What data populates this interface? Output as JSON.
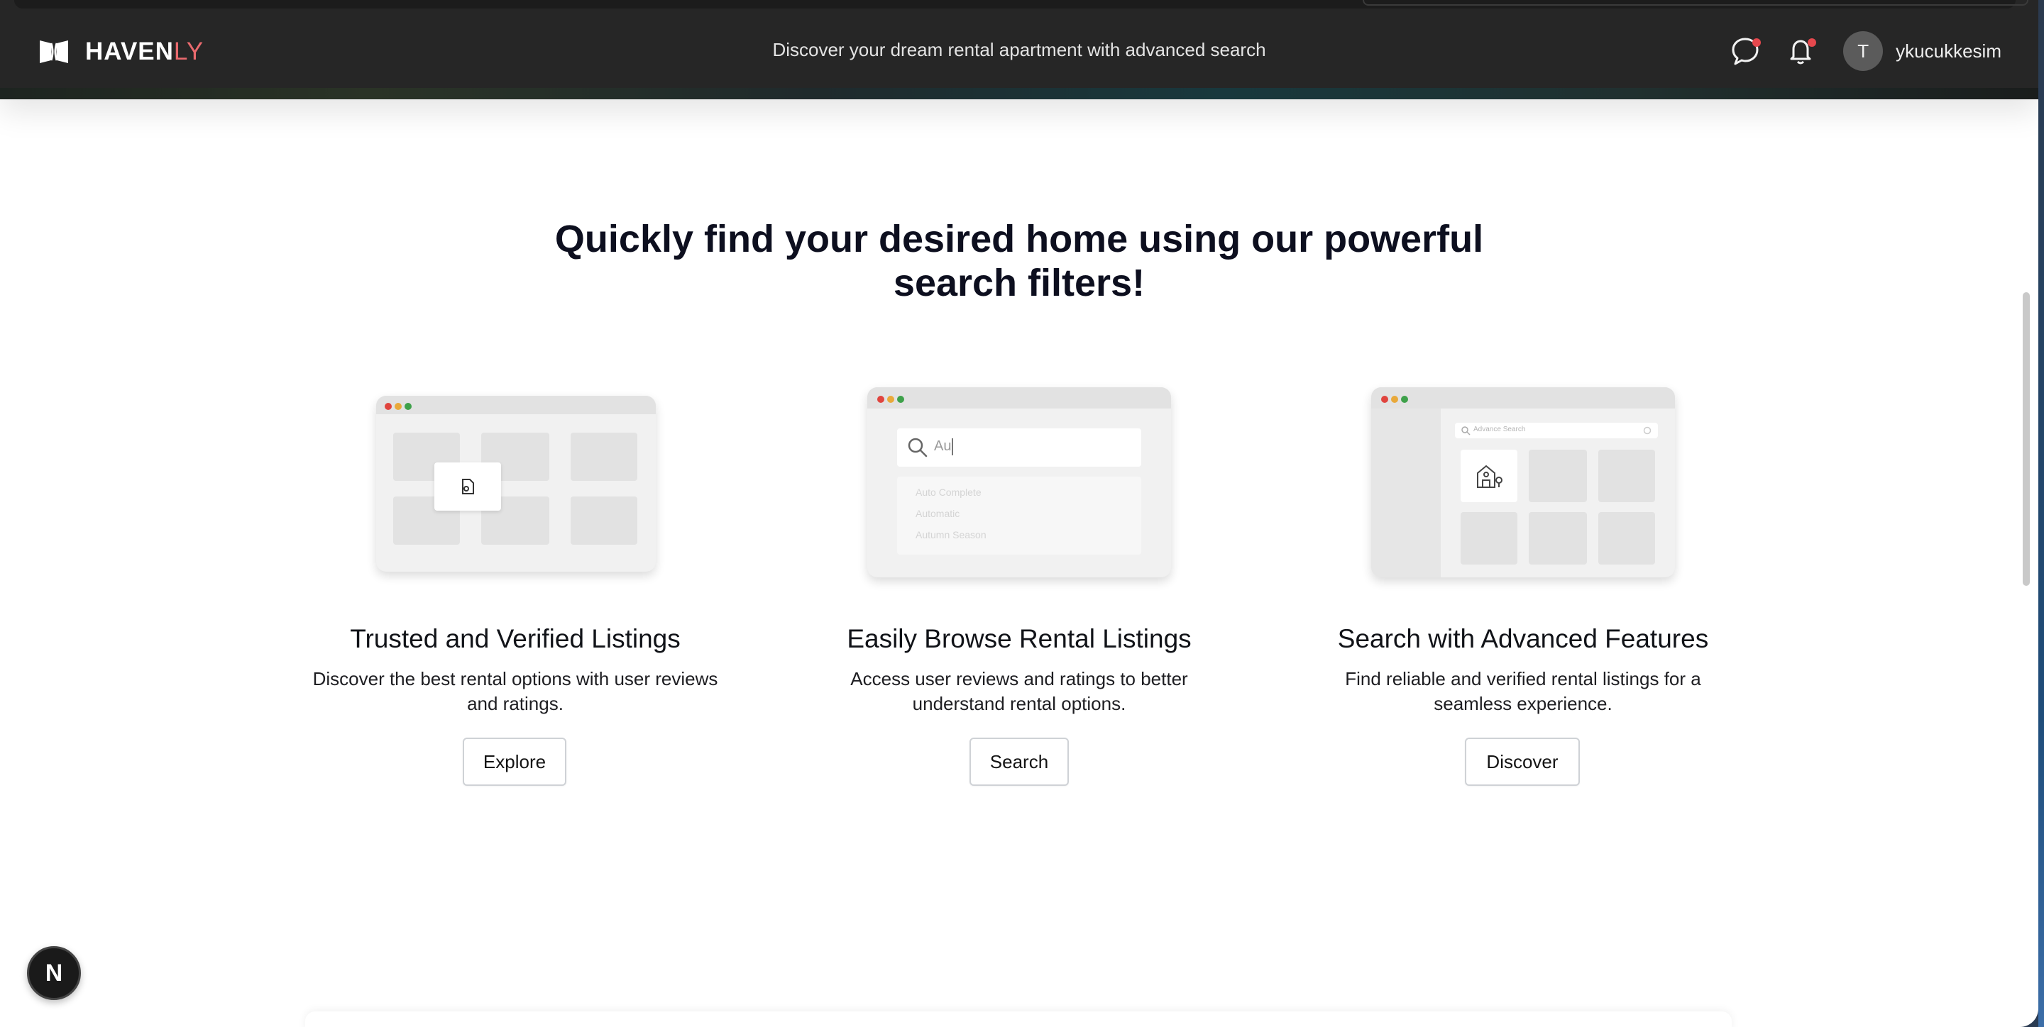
{
  "header": {
    "brand_main": "HAVEN",
    "brand_accent": "LY",
    "tagline": "Discover your dream rental apartment with advanced search",
    "user_initial": "T",
    "username": "ykucukkesim",
    "icons": [
      "logo-icon",
      "chat-icon",
      "bell-icon"
    ]
  },
  "main": {
    "headline_line1": "Quickly find your desired home using our powerful",
    "headline_line2": "search filters!",
    "features": [
      {
        "title": "Trusted and Verified Listings",
        "desc_line1": "Discover the best rental options with user reviews",
        "desc_line2": "and ratings.",
        "button": "Explore"
      },
      {
        "title": "Easily Browse Rental Listings",
        "desc_line1": "Access user reviews and ratings to better",
        "desc_line2": "understand rental options.",
        "button": "Search",
        "mock_search_text": "Au",
        "mock_suggestions": [
          "Auto Complete",
          "Automatic",
          "Autumn Season"
        ]
      },
      {
        "title": "Search with Advanced Features",
        "desc_line1": "Find reliable and verified rental listings for a",
        "desc_line2": "seamless experience.",
        "button": "Discover",
        "mock_search_placeholder": "Advance Search"
      }
    ]
  },
  "dev_badge": "N",
  "colors": {
    "topbar": "#262626",
    "brand_accent": "#ea6a6e",
    "notification_dot": "#e5484d",
    "headline": "#0d0f1f"
  }
}
